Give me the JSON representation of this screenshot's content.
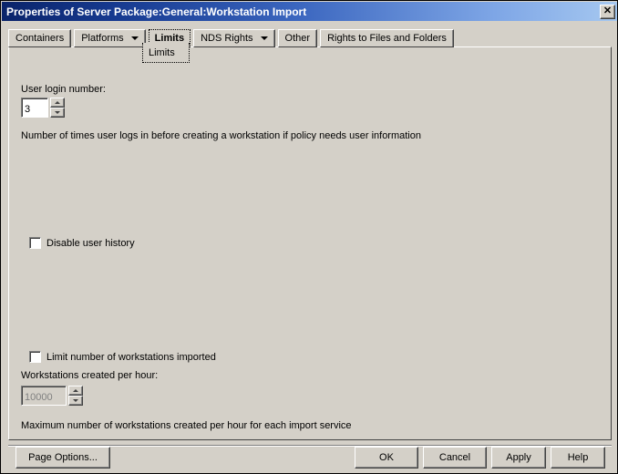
{
  "window": {
    "title": "Properties of Server Package:General:Workstation Import",
    "close_label": "✕"
  },
  "tabs": [
    {
      "label": "Containers",
      "has_caret": false,
      "selected": false
    },
    {
      "label": "Platforms",
      "has_caret": true,
      "selected": false
    },
    {
      "label": "Limits",
      "has_caret": false,
      "selected": true
    },
    {
      "label": "NDS Rights",
      "has_caret": true,
      "selected": false
    },
    {
      "label": "Other",
      "has_caret": false,
      "selected": false
    },
    {
      "label": "Rights to Files and Folders",
      "has_caret": false,
      "selected": false
    }
  ],
  "tab_dropdown": {
    "open": true,
    "items": [
      "Limits"
    ],
    "selected": "Limits"
  },
  "panel": {
    "user_login_number": {
      "label": "User login number:",
      "value": "3",
      "enabled": true
    },
    "user_login_description": "Number of times user logs in before creating a workstation if policy needs user information",
    "disable_user_history": {
      "label": "Disable user history",
      "checked": false
    },
    "limit_workstations": {
      "label": "Limit number of workstations imported",
      "checked": false
    },
    "workstations_per_hour": {
      "label": "Workstations created per hour:",
      "value": "10000",
      "enabled": false
    },
    "workstations_description": "Maximum number of workstations created per hour for each import service"
  },
  "buttons": {
    "page_options": "Page Options...",
    "ok": "OK",
    "cancel": "Cancel",
    "apply": "Apply",
    "help": "Help"
  },
  "colors": {
    "face": "#d4d0c8",
    "title_gradient_start": "#0a246a",
    "title_gradient_end": "#a6c8f0",
    "text": "#000000",
    "disabled_text": "#808080"
  }
}
